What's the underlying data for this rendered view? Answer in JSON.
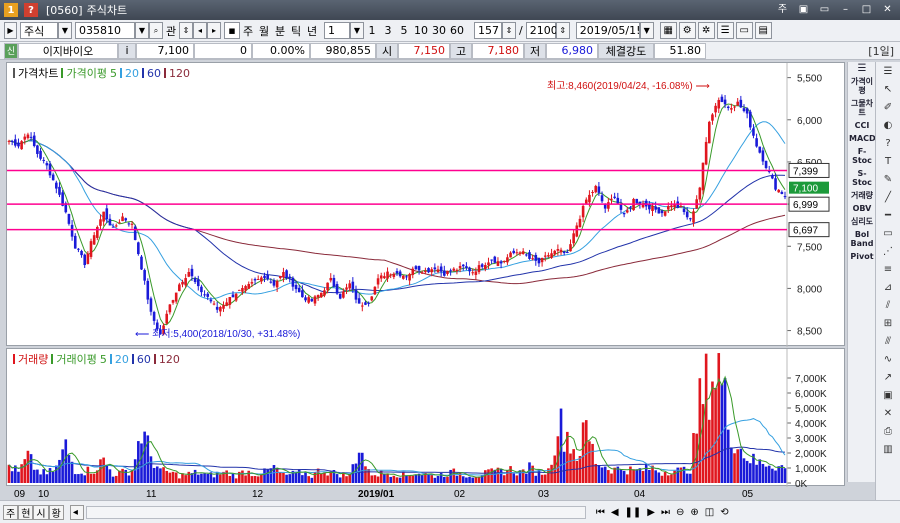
{
  "window": {
    "code": "[0560]",
    "title": "주식차트",
    "buttons": [
      "주",
      "▣",
      "▭",
      "–",
      "□",
      "✕"
    ]
  },
  "toolbar": {
    "market": "주식",
    "stock_code": "035810",
    "related_label": "관",
    "periods": [
      "주",
      "월",
      "분",
      "틱",
      "년"
    ],
    "interval_value": "1",
    "minutes": [
      "1",
      "3",
      "5",
      "10",
      "30",
      "60"
    ],
    "count_value": "157",
    "total_value": "2100",
    "slash": "/",
    "date_value": "2019/05/1!"
  },
  "info": {
    "tag": "신",
    "stock_name": "이지바이오",
    "info_btn": "i",
    "price": "7,100",
    "change": "0",
    "change_pct": "0.00%",
    "volume": "980,855",
    "open_label": "시",
    "open": "7,150",
    "high_label": "고",
    "high": "7,180",
    "low_label": "저",
    "low": "6,980",
    "strength_label": "체결강도",
    "strength": "51.80",
    "period_badge": "[1일]"
  },
  "price_panel": {
    "legend": [
      "가격차트",
      "가격이평",
      "5",
      "20",
      "60",
      "120"
    ],
    "y_ticks": [
      "8,500",
      "8,000",
      "7,500",
      "7,000",
      "6,500",
      "6,000",
      "5,500"
    ],
    "h_lines": [
      "7,399",
      "6,999",
      "6,697"
    ],
    "current_label": "7,100",
    "max_annotation": "최고:8,460(2019/04/24, -16.08%)",
    "min_annotation": "최저:5,400(2018/10/30, +31.48%)"
  },
  "volume_panel": {
    "legend": [
      "거래량",
      "거래이평",
      "5",
      "20",
      "60",
      "120"
    ],
    "y_ticks": [
      "7,000K",
      "6,000K",
      "5,000K",
      "4,000K",
      "3,000K",
      "2,000K",
      "1,000K",
      "0K"
    ]
  },
  "x_ticks": [
    "09",
    "10",
    "11",
    "12",
    "2019/01",
    "02",
    "03",
    "04",
    "05"
  ],
  "sidebar": [
    "가격이평",
    "그물차트",
    "CCI",
    "MACD",
    "F-Stoc",
    "S-Stoc",
    "거래량",
    "OBV",
    "심리도",
    "Bol Band",
    "Pivot"
  ],
  "bottom": {
    "tabs": [
      "주",
      "현",
      "시",
      "황"
    ],
    "scroll_left": "◂"
  },
  "colors": {
    "up": "#e0161e",
    "down": "#1a1ad8",
    "ma5": "#3a9a2a",
    "ma20": "#35a0e0",
    "ma60": "#2233aa",
    "ma120": "#8a2a3a",
    "hline": "#ff0090"
  },
  "chart_data": {
    "type": "candlestick",
    "title": "가격차트",
    "ylim": [
      5400,
      8460
    ],
    "y_ticks": [
      5500,
      6000,
      6500,
      7000,
      7500,
      8000,
      8500
    ],
    "x_ticks": [
      "09",
      "10",
      "11",
      "12",
      "2019/01",
      "02",
      "03",
      "04",
      "05"
    ],
    "horizontal_lines": [
      7399,
      6999,
      6697
    ],
    "last_close": 7100,
    "max": {
      "value": 8460,
      "date": "2019/04/24"
    },
    "min": {
      "value": 5400,
      "date": "2018/10/30"
    },
    "price_path": [
      [
        0,
        7750
      ],
      [
        3,
        7700
      ],
      [
        6,
        7850
      ],
      [
        9,
        7600
      ],
      [
        12,
        7450
      ],
      [
        15,
        7200
      ],
      [
        18,
        6900
      ],
      [
        21,
        6500
      ],
      [
        24,
        6300
      ],
      [
        27,
        6650
      ],
      [
        30,
        6900
      ],
      [
        33,
        6700
      ],
      [
        36,
        6850
      ],
      [
        39,
        6750
      ],
      [
        42,
        6250
      ],
      [
        45,
        5700
      ],
      [
        48,
        5450
      ],
      [
        51,
        5800
      ],
      [
        54,
        6050
      ],
      [
        57,
        6200
      ],
      [
        60,
        6000
      ],
      [
        63,
        5900
      ],
      [
        66,
        5750
      ],
      [
        69,
        5850
      ],
      [
        72,
        5950
      ],
      [
        75,
        6000
      ],
      [
        78,
        6080
      ],
      [
        81,
        6150
      ],
      [
        84,
        6050
      ],
      [
        87,
        6180
      ],
      [
        90,
        6050
      ],
      [
        93,
        5900
      ],
      [
        96,
        5850
      ],
      [
        99,
        5950
      ],
      [
        102,
        6100
      ],
      [
        105,
        5900
      ],
      [
        108,
        6050
      ],
      [
        111,
        5800
      ],
      [
        114,
        5850
      ],
      [
        117,
        6100
      ],
      [
        120,
        6200
      ],
      [
        123,
        6180
      ],
      [
        126,
        6150
      ],
      [
        129,
        6250
      ],
      [
        132,
        6200
      ],
      [
        135,
        6250
      ],
      [
        138,
        6180
      ],
      [
        141,
        6220
      ],
      [
        144,
        6250
      ],
      [
        147,
        6200
      ],
      [
        150,
        6280
      ],
      [
        153,
        6350
      ],
      [
        156,
        6300
      ],
      [
        159,
        6400
      ],
      [
        162,
        6450
      ],
      [
        165,
        6350
      ],
      [
        168,
        6300
      ],
      [
        171,
        6400
      ],
      [
        174,
        6450
      ],
      [
        177,
        6400
      ],
      [
        180,
        6750
      ],
      [
        183,
        7050
      ],
      [
        186,
        7200
      ],
      [
        189,
        6950
      ],
      [
        192,
        7100
      ],
      [
        195,
        6850
      ],
      [
        198,
        7050
      ],
      [
        201,
        7000
      ],
      [
        204,
        6950
      ],
      [
        207,
        6900
      ],
      [
        210,
        7000
      ],
      [
        213,
        6950
      ],
      [
        216,
        6800
      ],
      [
        219,
        7200
      ],
      [
        222,
        8000
      ],
      [
        225,
        8250
      ],
      [
        228,
        8150
      ],
      [
        231,
        8200
      ],
      [
        234,
        8050
      ],
      [
        237,
        7700
      ],
      [
        240,
        7450
      ],
      [
        243,
        7200
      ],
      [
        246,
        7100
      ]
    ],
    "volume_path": [
      [
        0,
        1200
      ],
      [
        3,
        700
      ],
      [
        6,
        1700
      ],
      [
        9,
        800
      ],
      [
        12,
        600
      ],
      [
        15,
        1000
      ],
      [
        18,
        2400
      ],
      [
        21,
        900
      ],
      [
        24,
        800
      ],
      [
        27,
        900
      ],
      [
        30,
        1500
      ],
      [
        33,
        600
      ],
      [
        36,
        700
      ],
      [
        39,
        900
      ],
      [
        42,
        3500
      ],
      [
        45,
        1800
      ],
      [
        48,
        800
      ],
      [
        51,
        700
      ],
      [
        54,
        500
      ],
      [
        57,
        600
      ],
      [
        60,
        700
      ],
      [
        63,
        500
      ],
      [
        66,
        600
      ],
      [
        69,
        700
      ],
      [
        72,
        500
      ],
      [
        75,
        800
      ],
      [
        78,
        600
      ],
      [
        81,
        700
      ],
      [
        84,
        1000
      ],
      [
        87,
        500
      ],
      [
        90,
        600
      ],
      [
        93,
        700
      ],
      [
        96,
        500
      ],
      [
        99,
        900
      ],
      [
        102,
        700
      ],
      [
        105,
        600
      ],
      [
        108,
        500
      ],
      [
        111,
        2500
      ],
      [
        114,
        700
      ],
      [
        117,
        600
      ],
      [
        120,
        700
      ],
      [
        123,
        600
      ],
      [
        126,
        500
      ],
      [
        129,
        700
      ],
      [
        132,
        600
      ],
      [
        135,
        500
      ],
      [
        138,
        600
      ],
      [
        141,
        700
      ],
      [
        144,
        600
      ],
      [
        147,
        500
      ],
      [
        150,
        600
      ],
      [
        153,
        700
      ],
      [
        156,
        800
      ],
      [
        159,
        900
      ],
      [
        162,
        700
      ],
      [
        165,
        1000
      ],
      [
        168,
        700
      ],
      [
        171,
        800
      ],
      [
        174,
        4000
      ],
      [
        177,
        3200
      ],
      [
        180,
        1800
      ],
      [
        183,
        3600
      ],
      [
        186,
        1500
      ],
      [
        189,
        1100
      ],
      [
        192,
        900
      ],
      [
        195,
        1000
      ],
      [
        198,
        800
      ],
      [
        201,
        900
      ],
      [
        204,
        1000
      ],
      [
        207,
        700
      ],
      [
        210,
        900
      ],
      [
        213,
        800
      ],
      [
        216,
        1000
      ],
      [
        219,
        5200
      ],
      [
        222,
        7000
      ],
      [
        225,
        7700
      ],
      [
        228,
        4200
      ],
      [
        231,
        2500
      ],
      [
        234,
        1800
      ],
      [
        237,
        1300
      ],
      [
        240,
        1400
      ],
      [
        243,
        1200
      ],
      [
        246,
        980
      ]
    ]
  }
}
